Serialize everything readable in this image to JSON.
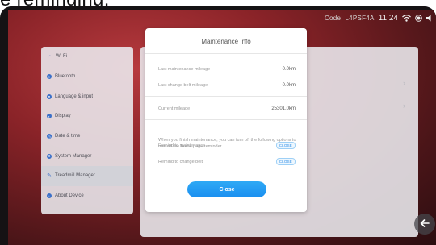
{
  "caption": {
    "text": "e reminding."
  },
  "status": {
    "code": "Code: L4PSF4A",
    "time": "11:24",
    "wifi_icon": "wifi-icon",
    "record_icon": "record-icon",
    "volume_icon": "volume-icon"
  },
  "sidebar": {
    "items": [
      {
        "label": "Wi-Fi",
        "icon": "wifi-icon"
      },
      {
        "label": "Bluetooth",
        "icon": "bluetooth-icon"
      },
      {
        "label": "Language & input",
        "icon": "language-icon"
      },
      {
        "label": "Display",
        "icon": "display-icon"
      },
      {
        "label": "Date & time",
        "icon": "clock-icon"
      },
      {
        "label": "System Manager",
        "icon": "system-icon"
      },
      {
        "label": "Treadmill Manager",
        "icon": "wrench-icon",
        "active": true
      },
      {
        "label": "About Device",
        "icon": "info-icon"
      }
    ]
  },
  "dialog": {
    "title": "Maintenance Info",
    "rows": [
      {
        "label": "Last maintenance mileage",
        "value": "0.0km"
      },
      {
        "label": "Last change belt mileage",
        "value": "0.0km"
      },
      {
        "label": "Current mileage",
        "value": "25301.0km"
      }
    ],
    "note": "When you finish maintenance, you can turn off the following options to turn off the home page reminder",
    "toggles": [
      {
        "label": "Remind to maintenance",
        "state": "CLOSE"
      },
      {
        "label": "Remind to change belt",
        "state": "CLOSE"
      }
    ],
    "close_label": "Close"
  },
  "back_icon": "arrow-left-icon",
  "colors": {
    "accent": "#1b8ff0",
    "background": "#8a2328"
  }
}
